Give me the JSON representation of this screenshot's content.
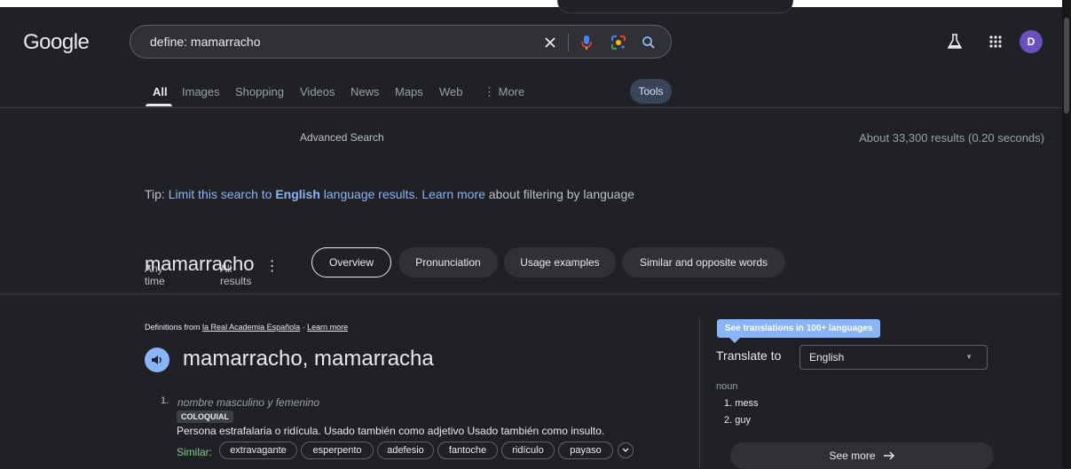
{
  "header": {
    "logo": "Google",
    "search_value": "define: mamarracho",
    "avatar_initial": "D"
  },
  "tabs": [
    "All",
    "Images",
    "Shopping",
    "Videos",
    "News",
    "Maps",
    "Web",
    "More"
  ],
  "tools_label": "Tools",
  "filters": {
    "time": "Any time",
    "results": "All results",
    "advanced": "Advanced Search"
  },
  "result_stats": "About 33,300 results (0.20 seconds)",
  "tip": {
    "prefix": "Tip:",
    "limit_text": "Limit this search to",
    "language": "English",
    "lang_results": "language results.",
    "learn_more": "Learn more",
    "suffix": "about filtering by language"
  },
  "dictionary": {
    "title": "mamarracho",
    "chips": [
      "Overview",
      "Pronunciation",
      "Usage examples",
      "Similar and opposite words"
    ],
    "source_prefix": "Definitions from",
    "source_name": "la Real Academia Española",
    "source_dot": "·",
    "source_learn": "Learn more",
    "headword": "mamarracho, mamarracha",
    "sense_number": "1.",
    "part_of_speech": "nombre masculino y femenino",
    "register": "COLOQUIAL",
    "gloss": "Persona estrafalaria o ridícula. Usado también como adjetivo Usado también como insulto.",
    "similar_label": "Similar:",
    "similar": [
      "extravagante",
      "esperpento",
      "adefesio",
      "fantoche",
      "ridículo",
      "payaso"
    ]
  },
  "translation": {
    "badge": "See translations in 100+ languages",
    "translate_to": "Translate to",
    "language": "English",
    "pos": "noun",
    "items": [
      "1. mess",
      "2. guy"
    ],
    "see_more": "See more"
  },
  "colors": {
    "background": "#202124",
    "link": "#8ab4f8",
    "similar_label": "#81c995",
    "avatar": "#6a4fc1"
  }
}
